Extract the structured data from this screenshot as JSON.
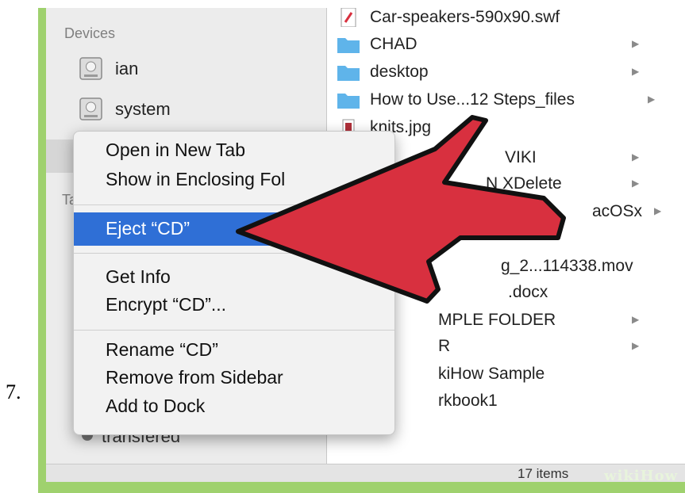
{
  "step_number": "7.",
  "sidebar": {
    "devices_heading": "Devices",
    "devices": [
      "ian",
      "system"
    ],
    "tags_heading_partial": "Ta",
    "bottom_item_partial": "transfered"
  },
  "files": [
    {
      "name": "Car-speakers-590x90.swf",
      "kind": "swf",
      "has_chevron": false
    },
    {
      "name": "CHAD",
      "kind": "folder",
      "has_chevron": true
    },
    {
      "name": "desktop",
      "kind": "folder",
      "has_chevron": true
    },
    {
      "name": "How to Use...12 Steps_files",
      "kind": "folder",
      "has_chevron": true
    },
    {
      "name": "knits.jpg",
      "kind": "image",
      "has_chevron": false
    },
    {
      "name": "VIKI",
      "kind": "folder",
      "has_chevron": true
    },
    {
      "name": "N XDelete",
      "kind": "folder",
      "has_chevron": true
    },
    {
      "name": "acOSx",
      "kind": "folder",
      "has_chevron": true
    },
    {
      "name": "g_2...114338.mov",
      "kind": "file",
      "has_chevron": false
    },
    {
      "name": ".docx",
      "kind": "file",
      "has_chevron": false
    },
    {
      "name": "MPLE FOLDER",
      "kind": "folder",
      "has_chevron": true
    },
    {
      "name": "R",
      "kind": "folder",
      "has_chevron": true
    },
    {
      "name": "kiHow Sample",
      "kind": "file",
      "has_chevron": false
    },
    {
      "name": "rkbook1",
      "kind": "file",
      "has_chevron": false
    }
  ],
  "context_menu": {
    "group1": [
      "Open in New Tab",
      "Show in Enclosing Fol"
    ],
    "highlighted": "Eject “CD”",
    "group2": [
      "Get Info",
      "Encrypt “CD”..."
    ],
    "group3": [
      "Rename “CD”",
      "Remove from Sidebar",
      "Add to Dock"
    ]
  },
  "status": {
    "text": "17 items"
  },
  "watermark": "wikiHow",
  "colors": {
    "frame": "#9fd16e",
    "highlight": "#2f6fd6",
    "arrow": "#d8303f",
    "folder": "#5fb4ea"
  }
}
